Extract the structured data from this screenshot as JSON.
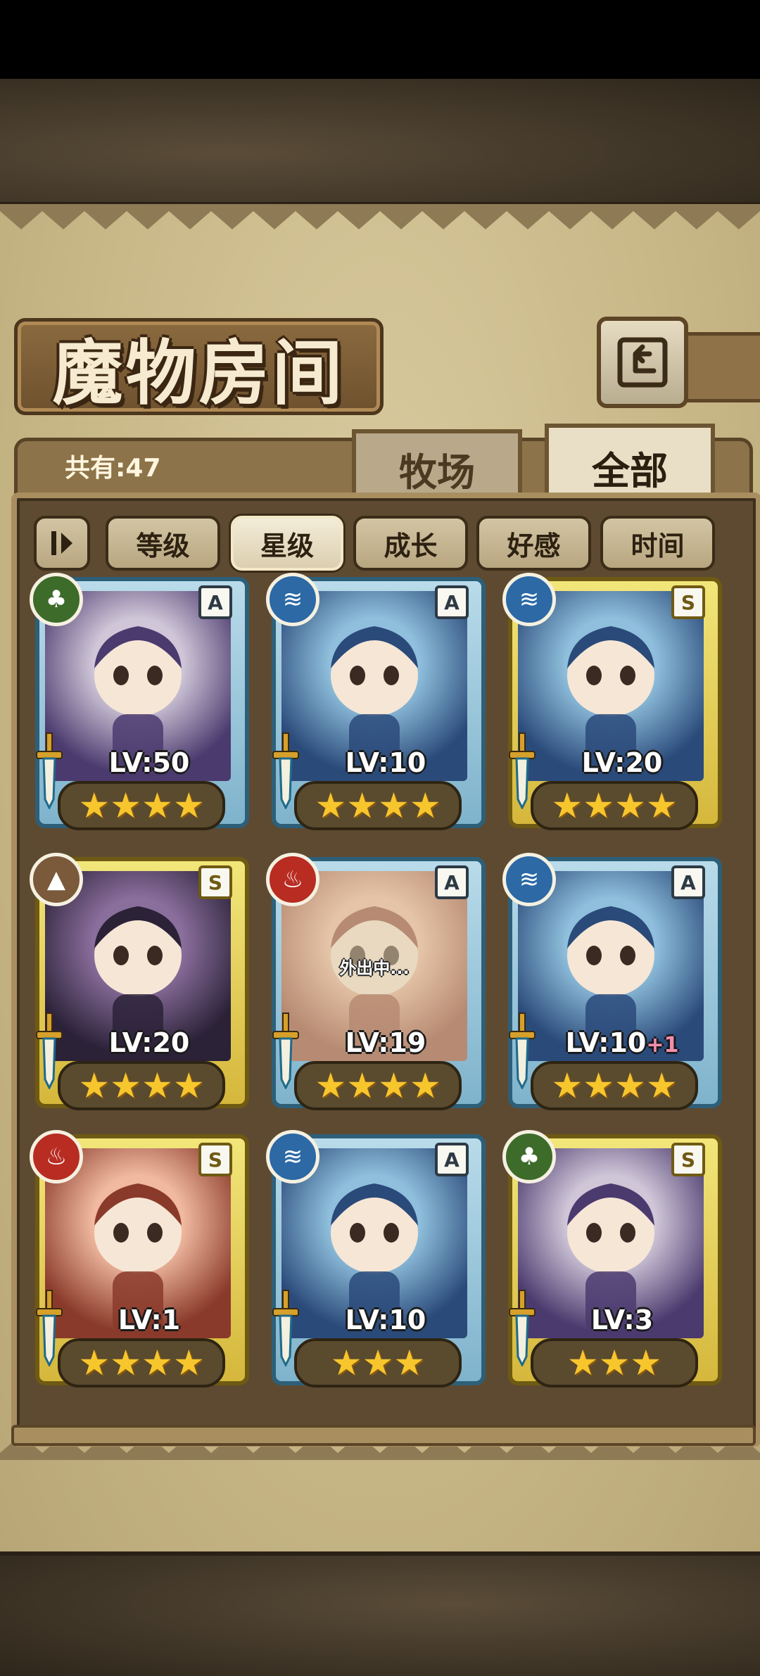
{
  "header": {
    "title": "魔物房间",
    "back_icon": "return-icon"
  },
  "collection": {
    "count_label": "共有:47"
  },
  "tabs": [
    {
      "label": "牧场",
      "active": false
    },
    {
      "label": "全部",
      "active": true
    }
  ],
  "sort_buttons": [
    {
      "label": "等级",
      "active": false
    },
    {
      "label": "星级",
      "active": true
    },
    {
      "label": "成长",
      "active": false
    },
    {
      "label": "好感",
      "active": false
    },
    {
      "label": "时间",
      "active": false
    }
  ],
  "monsters": [
    {
      "element": "grass",
      "rank": "A",
      "frame": "blue",
      "level": "LV:50",
      "bonus": "",
      "stars": "★★★★",
      "away_text": ""
    },
    {
      "element": "water",
      "rank": "A",
      "frame": "blue",
      "level": "LV:10",
      "bonus": "",
      "stars": "★★★★",
      "away_text": ""
    },
    {
      "element": "water",
      "rank": "S",
      "frame": "gold",
      "level": "LV:20",
      "bonus": "",
      "stars": "★★★★",
      "away_text": ""
    },
    {
      "element": "earth",
      "rank": "S",
      "frame": "gold",
      "level": "LV:20",
      "bonus": "",
      "stars": "★★★★",
      "away_text": ""
    },
    {
      "element": "fire",
      "rank": "A",
      "frame": "blue",
      "level": "LV:19",
      "bonus": "",
      "stars": "★★★★",
      "away_text": "外出中..."
    },
    {
      "element": "water",
      "rank": "A",
      "frame": "blue",
      "level": "LV:10",
      "bonus": "+1",
      "stars": "★★★★",
      "away_text": ""
    },
    {
      "element": "fire",
      "rank": "S",
      "frame": "gold",
      "level": "LV:1",
      "bonus": "",
      "stars": "★★★★",
      "away_text": ""
    },
    {
      "element": "water",
      "rank": "A",
      "frame": "blue",
      "level": "LV:10",
      "bonus": "",
      "stars": "★★★",
      "away_text": ""
    },
    {
      "element": "grass",
      "rank": "S",
      "frame": "gold",
      "level": "LV:3",
      "bonus": "",
      "stars": "★★★",
      "away_text": ""
    }
  ],
  "colors": {
    "parchment": "#c9b888",
    "frame_dark": "#5e4a31",
    "star": "#f7c62d",
    "blue_frame": "#7fb3cc",
    "gold_frame": "#d5b73c"
  }
}
